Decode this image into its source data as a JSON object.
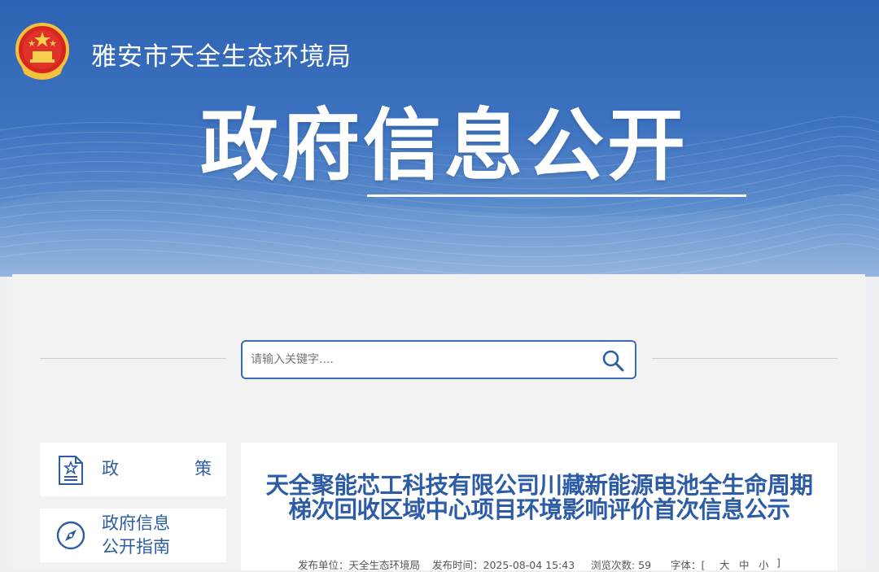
{
  "header": {
    "agency_name": "雅安市天全生态环境局",
    "section_title": "政府信息公开"
  },
  "search": {
    "placeholder": "请输入关键字...."
  },
  "sidebar": {
    "items": [
      {
        "label_line1": "政",
        "label_line2": "策",
        "icon": "policy-document-icon"
      },
      {
        "label_line1": "政府信息",
        "label_line2": "公开指南",
        "icon": "compass-icon"
      }
    ]
  },
  "article": {
    "title": "天全聚能芯工科技有限公司川藏新能源电池全生命周期梯次回收区域中心项目环境影响评价首次信息公示",
    "publisher": "发布单位：天全生态环境局",
    "publish_time": "发布时间：2025-08-04 15:43",
    "views": "浏览次数: 59",
    "font_size_label": "字体：[",
    "font_large": "大",
    "font_medium": "中",
    "font_small": "小",
    "font_close": "]"
  },
  "colors": {
    "banner_blue": "#2e63b3",
    "accent_blue": "#2d5ca6",
    "panel_bg": "#f2f2f2"
  }
}
